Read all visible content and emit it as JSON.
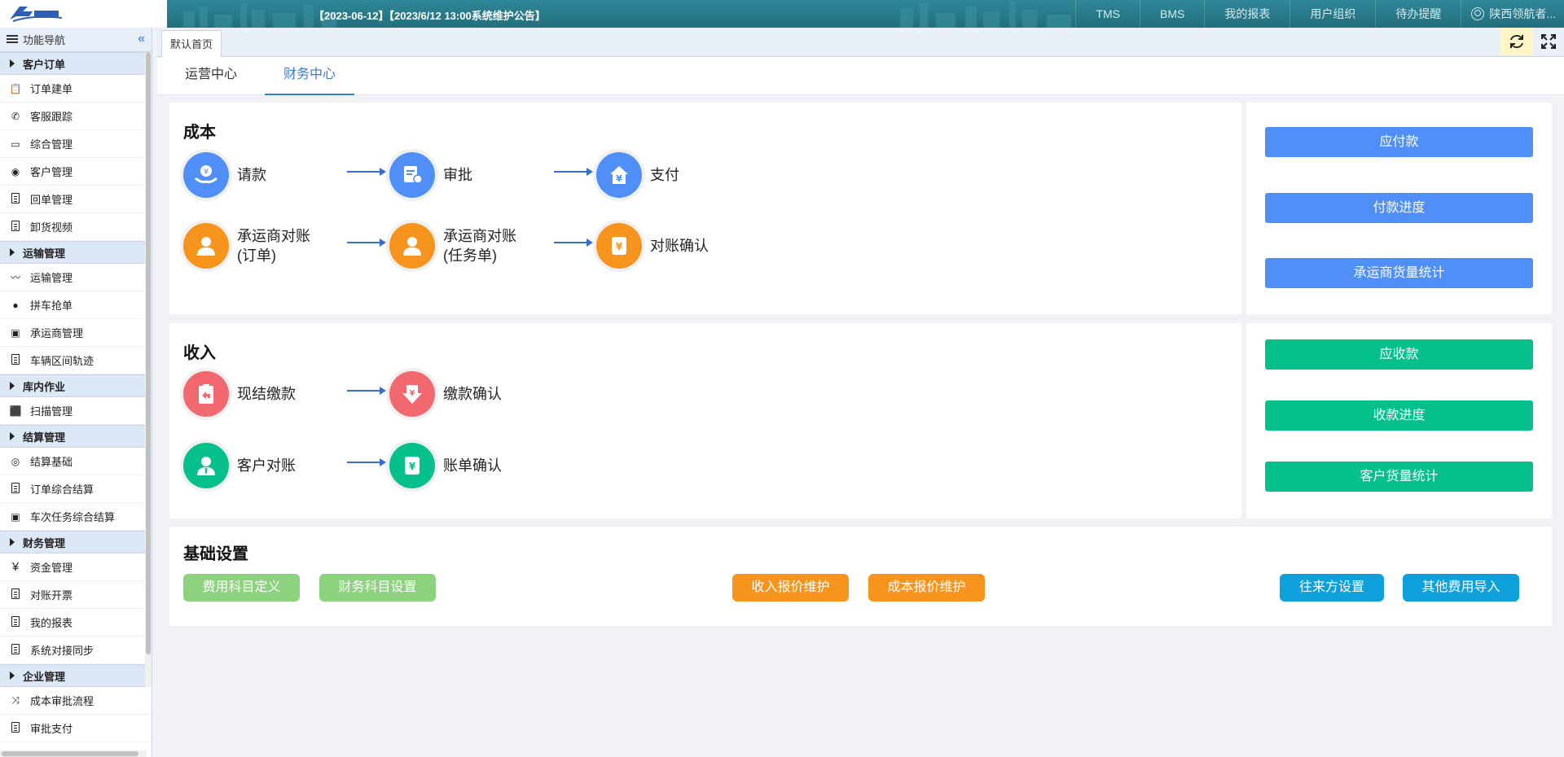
{
  "header": {
    "notice": "【2023-06-12】【2023/6/12 13:00系统维护公告】",
    "nav": [
      "TMS",
      "BMS",
      "我的报表",
      "用户组织",
      "待办提醒"
    ],
    "user": "陕西领航者..."
  },
  "sidebar": {
    "title": "功能导航",
    "groups": [
      {
        "label": "客户订单",
        "items": [
          "订单建单",
          "客服跟踪",
          "综合管理",
          "客户管理",
          "回单管理",
          "卸货视频"
        ]
      },
      {
        "label": "运输管理",
        "items": [
          "运输管理",
          "拼车抢单",
          "承运商管理",
          "车辆区间轨迹"
        ]
      },
      {
        "label": "库内作业",
        "items": [
          "扫描管理"
        ]
      },
      {
        "label": "结算管理",
        "items": [
          "结算基础",
          "订单综合结算",
          "车次任务综合结算"
        ]
      },
      {
        "label": "财务管理",
        "items": [
          "资金管理",
          "对账开票",
          "我的报表",
          "系统对接同步"
        ]
      },
      {
        "label": "企业管理",
        "items": [
          "成本审批流程",
          "审批支付"
        ]
      }
    ]
  },
  "tabs": {
    "home": "默认首页"
  },
  "subtabs": [
    "运营中心",
    "财务中心"
  ],
  "cost": {
    "title": "成本",
    "row1": [
      "请款",
      "审批",
      "支付"
    ],
    "row2": [
      {
        "line1": "承运商对账",
        "line2": "(订单)"
      },
      {
        "line1": "承运商对账",
        "line2": "(任务单)"
      },
      {
        "line1": "对账确认",
        "line2": ""
      }
    ],
    "buttons": [
      "应付款",
      "付款进度",
      "承运商货量统计"
    ]
  },
  "income": {
    "title": "收入",
    "row1": [
      "现结缴款",
      "缴款确认"
    ],
    "row2": [
      "客户对账",
      "账单确认"
    ],
    "buttons": [
      "应收款",
      "收款进度",
      "客户货量统计"
    ]
  },
  "basic": {
    "title": "基础设置",
    "buttons": [
      "费用科目定义",
      "财务科目设置",
      "收入报价维护",
      "成本报价维护",
      "往来方设置",
      "其他费用导入"
    ]
  },
  "colors": {
    "blue": "#4f8ff7",
    "orange": "#f7941d",
    "red": "#f2686f",
    "teal": "#06c08c",
    "green": "#8cd27f",
    "cyan": "#0ea0db"
  }
}
